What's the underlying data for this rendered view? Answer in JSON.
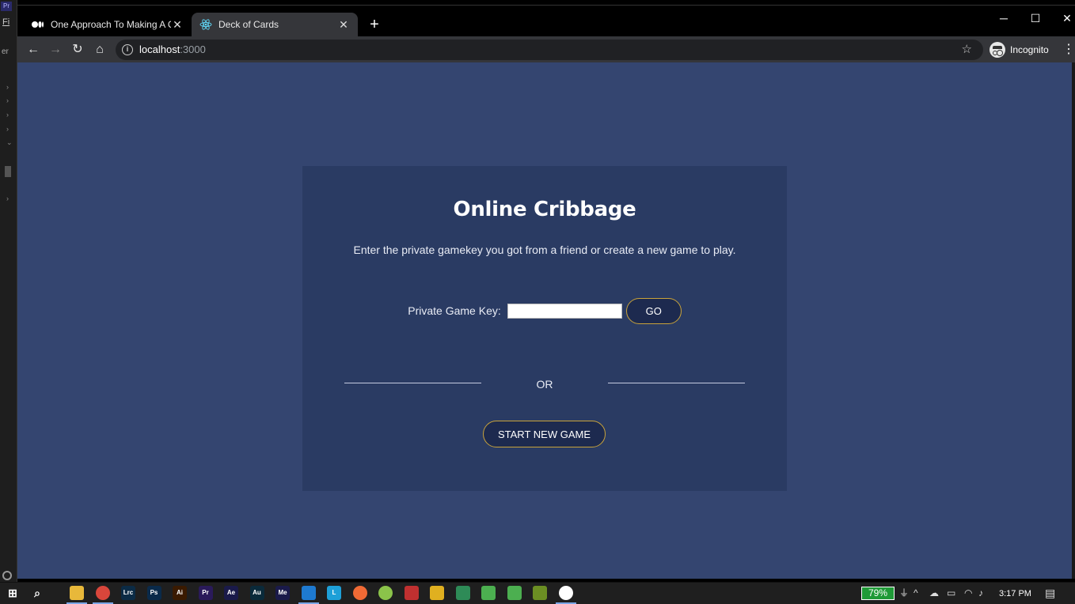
{
  "background_app": {
    "badge": "Pr",
    "menu_text": "Fi",
    "side_text": "er"
  },
  "browser": {
    "tabs": [
      {
        "title": "One Approach To Making A Card",
        "favicon": "medium-logo-icon",
        "active": false
      },
      {
        "title": "Deck of Cards",
        "favicon": "react-logo-icon",
        "active": true
      }
    ],
    "url_host": "localhost",
    "url_port": ":3000",
    "profile_label": "Incognito"
  },
  "page": {
    "title": "Online Cribbage",
    "subtitle": "Enter the private gamekey you got from a friend or create a new game to play.",
    "key_label": "Private Game Key:",
    "key_value": "",
    "go_label": "GO",
    "or_label": "OR",
    "new_game_label": "START NEW GAME",
    "colors": {
      "background": "#344570",
      "card": "#2a3b63",
      "button_fill": "#1d2a4f",
      "button_border": "#c9a33a"
    }
  },
  "taskbar": {
    "battery": "79%",
    "time": "3:17 PM",
    "apps": [
      {
        "name": "file-explorer",
        "label": "",
        "color": "#e8b83a"
      },
      {
        "name": "chrome",
        "label": "",
        "color": "#d9463b"
      },
      {
        "name": "lightroom-classic",
        "label": "Lrc",
        "color": "#0b2b45"
      },
      {
        "name": "photoshop",
        "label": "Ps",
        "color": "#0a2a4a"
      },
      {
        "name": "illustrator",
        "label": "Ai",
        "color": "#3a1a00"
      },
      {
        "name": "premiere-pro",
        "label": "Pr",
        "color": "#2a1a5a"
      },
      {
        "name": "after-effects",
        "label": "Ae",
        "color": "#1a1a4a"
      },
      {
        "name": "audition",
        "label": "Au",
        "color": "#0a2a3a"
      },
      {
        "name": "media-encoder",
        "label": "Me",
        "color": "#1a1a4a"
      },
      {
        "name": "vscode",
        "label": "",
        "color": "#1e7ad0"
      },
      {
        "name": "lucid",
        "label": "L",
        "color": "#1ea0d8"
      },
      {
        "name": "postman",
        "label": "",
        "color": "#f06a35"
      },
      {
        "name": "android-studio",
        "label": "",
        "color": "#8bc34a"
      },
      {
        "name": "game-app",
        "label": "",
        "color": "#c03030"
      },
      {
        "name": "pen-app",
        "label": "",
        "color": "#e0b020"
      },
      {
        "name": "terminal-app",
        "label": "",
        "color": "#2e8b57"
      },
      {
        "name": "tool-app-1",
        "label": "",
        "color": "#4caf50"
      },
      {
        "name": "tool-app-2",
        "label": "",
        "color": "#4caf50"
      },
      {
        "name": "tree-app",
        "label": "",
        "color": "#6b8e23"
      },
      {
        "name": "globe-app",
        "label": "",
        "color": "#ffffff"
      }
    ]
  }
}
